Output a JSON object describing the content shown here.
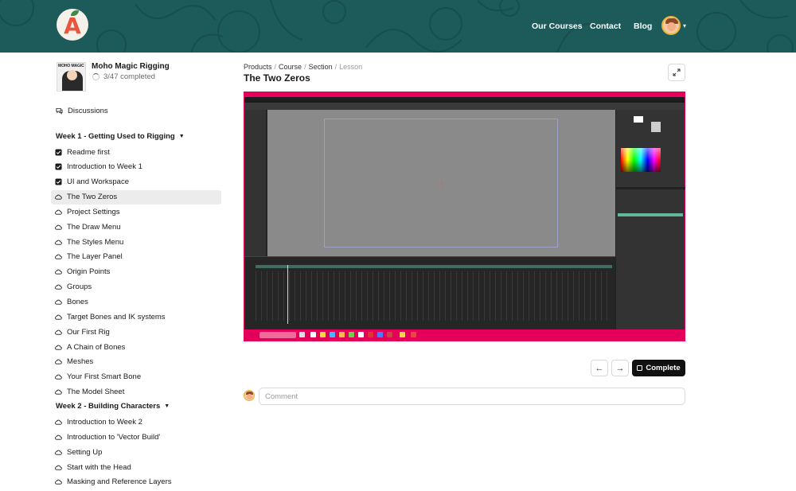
{
  "header": {
    "logo_letter": "A",
    "nav": [
      "Our Courses",
      "Contact",
      "Blog"
    ],
    "colors": {
      "header_bg": "#1d5a5a",
      "logo_accent": "#e8553b"
    }
  },
  "sidebar": {
    "course": {
      "thumbnail_text": "MOHO MAGIC",
      "title": "Moho Magic Rigging",
      "progress": "3/47 completed",
      "progress_fraction": 0.064
    },
    "discussions_label": "Discussions",
    "sections": [
      {
        "title": "Week 1 - Getting Used to Rigging",
        "lessons": [
          {
            "label": "Readme first",
            "status": "completed"
          },
          {
            "label": "Introduction to Week 1",
            "status": "completed"
          },
          {
            "label": "UI and Workspace",
            "status": "completed"
          },
          {
            "label": "The Two Zeros",
            "status": "active"
          },
          {
            "label": "Project Settings",
            "status": "pending"
          },
          {
            "label": "The Draw Menu",
            "status": "pending"
          },
          {
            "label": "The Styles Menu",
            "status": "pending"
          },
          {
            "label": "The Layer Panel",
            "status": "pending"
          },
          {
            "label": "Origin Points",
            "status": "pending"
          },
          {
            "label": "Groups",
            "status": "pending"
          },
          {
            "label": "Bones",
            "status": "pending"
          },
          {
            "label": "Target Bones and IK systems",
            "status": "pending"
          },
          {
            "label": "Our First Rig",
            "status": "pending"
          },
          {
            "label": "A Chain of Bones",
            "status": "pending"
          },
          {
            "label": "Meshes",
            "status": "pending"
          },
          {
            "label": "Your First Smart Bone",
            "status": "pending"
          },
          {
            "label": "The Model Sheet",
            "status": "pending"
          }
        ]
      },
      {
        "title": "Week 2 - Building Characters",
        "lessons": [
          {
            "label": "Introduction to Week 2",
            "status": "pending"
          },
          {
            "label": "Introduction to 'Vector Build'",
            "status": "pending"
          },
          {
            "label": "Setting Up",
            "status": "pending"
          },
          {
            "label": "Start with the Head",
            "status": "pending"
          },
          {
            "label": "Masking and Reference Layers",
            "status": "pending"
          }
        ]
      }
    ]
  },
  "main": {
    "breadcrumb": [
      "Products",
      "Course",
      "Section",
      "Lesson"
    ],
    "title": "The Two Zeros",
    "complete_label": "Complete",
    "comment_placeholder": "Comment",
    "video_colors": {
      "frame": "#e4005a",
      "app_bg": "#2b2b2b",
      "canvas": "#8a8a8a"
    }
  }
}
